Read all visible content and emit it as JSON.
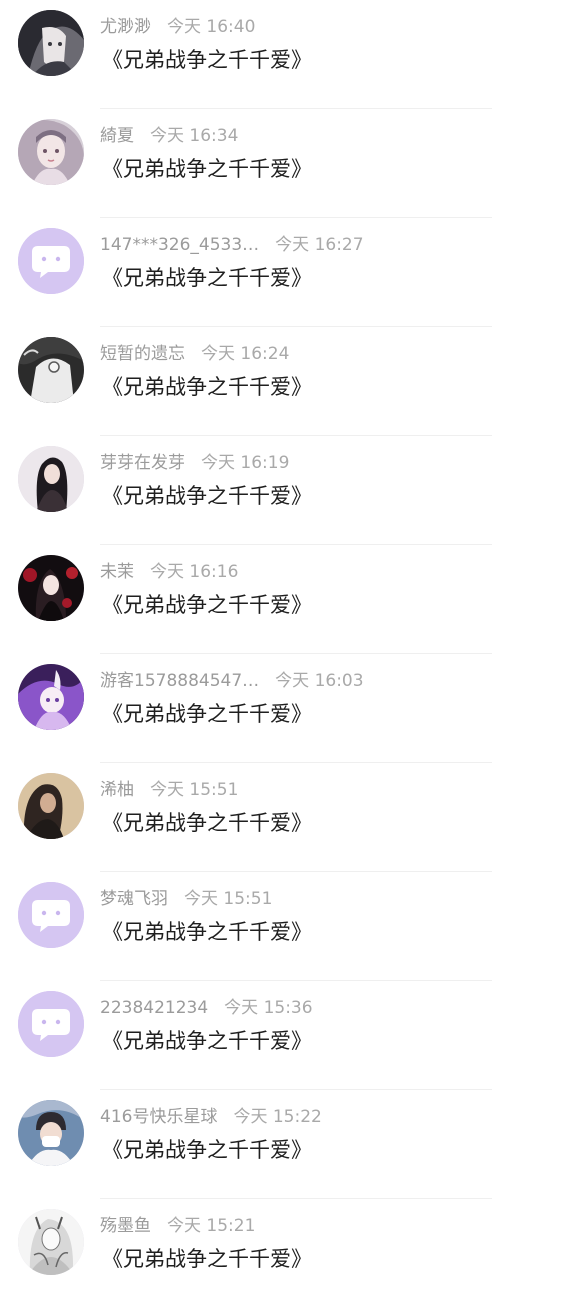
{
  "messages": [
    {
      "name": "尤渺渺",
      "time": "今天 16:40",
      "text": "《兄弟战争之千千爱》",
      "avatar": "photo-avatar-dark-hair"
    },
    {
      "name": "綺夏",
      "time": "今天 16:34",
      "text": "《兄弟战争之千千爱》",
      "avatar": "photo-avatar-illustrated-girl"
    },
    {
      "name": "147***326_4533…",
      "time": "今天 16:27",
      "text": "《兄弟战争之千千爱》",
      "avatar": "default-chat-bubble-avatar"
    },
    {
      "name": "短暂的遗忘",
      "time": "今天 16:24",
      "text": "《兄弟战争之千千爱》",
      "avatar": "photo-avatar-monochrome"
    },
    {
      "name": "芽芽在发芽",
      "time": "今天 16:19",
      "text": "《兄弟战争之千千爱》",
      "avatar": "photo-avatar-long-hair"
    },
    {
      "name": "未茉",
      "time": "今天 16:16",
      "text": "《兄弟战争之千千爱》",
      "avatar": "photo-avatar-red-dark"
    },
    {
      "name": "游客1578884547…",
      "time": "今天 16:03",
      "text": "《兄弟战争之千千爱》",
      "avatar": "photo-avatar-purple-anime"
    },
    {
      "name": "浠柚",
      "time": "今天 15:51",
      "text": "《兄弟战争之千千爱》",
      "avatar": "photo-avatar-beige-portrait"
    },
    {
      "name": "梦魂飞羽",
      "time": "今天 15:51",
      "text": "《兄弟战争之千千爱》",
      "avatar": "default-chat-bubble-avatar"
    },
    {
      "name": "2238421234",
      "time": "今天 15:36",
      "text": "《兄弟战争之千千爱》",
      "avatar": "default-chat-bubble-avatar"
    },
    {
      "name": "416号快乐星球",
      "time": "今天 15:22",
      "text": "《兄弟战争之千千爱》",
      "avatar": "photo-avatar-masked-person"
    },
    {
      "name": "殇墨鱼",
      "time": "今天 15:21",
      "text": "《兄弟战争之千千爱》",
      "avatar": "photo-avatar-sketch"
    }
  ],
  "colors": {
    "default_avatar_bg": "#d5c6f2",
    "name_text": "#9b9b9b",
    "time_text": "#a9a9a9",
    "message_text": "#1f1f1f",
    "divider": "#efefef"
  }
}
